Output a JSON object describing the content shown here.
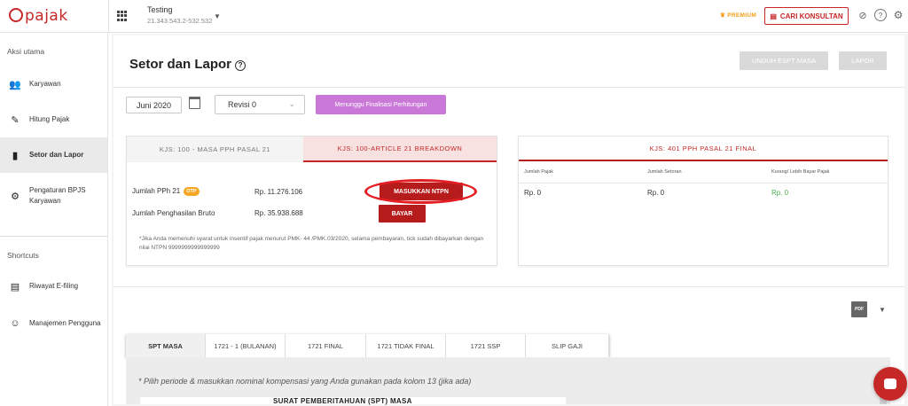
{
  "app": {
    "logo": "pajak"
  },
  "header": {
    "company_name": "Testing",
    "company_npwp": "21.343.543.2-532.532",
    "premium_label": "PREMIUM",
    "konsultan_label": "CARI KONSULTAN"
  },
  "sidebar": {
    "section_main": "Aksi utama",
    "items": [
      {
        "label": "Karyawan",
        "icon": "people-icon"
      },
      {
        "label": "Hitung Pajak",
        "icon": "pencil-icon"
      },
      {
        "label": "Setor dan Lapor",
        "icon": "document-icon"
      },
      {
        "label": "Pengaturan BPJS Karyawan",
        "icon": "gear-icon"
      }
    ],
    "section_shortcuts": "Shortcuts",
    "shortcuts": [
      {
        "label": "Riwayat E-filing",
        "icon": "history-icon"
      },
      {
        "label": "Manajemen Pengguna",
        "icon": "users-icon"
      }
    ]
  },
  "page": {
    "title": "Setor dan Lapor",
    "unduh_label": "UNDUH ESPT MASA",
    "lapor_label": "LAPOR",
    "period_value": "Juni 2020",
    "revisi_value": "Revisi 0",
    "status_label": "Menunggu Finalisasi Perhitungan"
  },
  "panel_left": {
    "tab_inactive": "KJS: 100 - MASA PPH PASAL 21",
    "tab_active": "KJS: 100-ARTICLE 21 BREAKDOWN",
    "row1_label": "Jumlah PPh 21",
    "otp_badge": "OTP",
    "row1_value": "Rp. 11.276.106",
    "row2_label": "Jumlah Penghasilan Bruto",
    "row2_value": "Rp. 35.938.688",
    "ntpn_button": "MASUKKAN NTPN",
    "bayar_button": "BAYAR",
    "note": "*Jika Anda memenuhi syarat untuk insentif pajak menurut PMK- 44 /PMK.03/2020, selama pembayaran, tick sudah dibayarkan dengan nilai NTPN 9999999999999999"
  },
  "panel_right": {
    "header": "KJS: 401 PPH PASAL 21 FINAL",
    "columns": [
      "Jumlah Pajak",
      "Jumlah Setoran",
      "Kurang/ Lebih Bayar Pajak"
    ],
    "values": [
      "Rp. 0",
      "Rp. 0",
      "Rp. 0"
    ]
  },
  "export": {
    "pdf_label": "PDF"
  },
  "spt_tabs": [
    "SPT MASA",
    "1721 - 1 (BULANAN)",
    "1721 FINAL",
    "1721 TIDAK FINAL",
    "1721 SSP",
    "SLIP GAJI"
  ],
  "document": {
    "note": "* Pilih periode & masukkan nominal kompensasi yang Anda gunakan pada kolom 13 (jika ada)",
    "title": "SURAT PEMBERITAHUAN (SPT) MASA"
  },
  "colors": {
    "brand": "#c62828",
    "status_pill": "#c978d8",
    "premium": "#f39c12",
    "positive": "#4caf50"
  }
}
